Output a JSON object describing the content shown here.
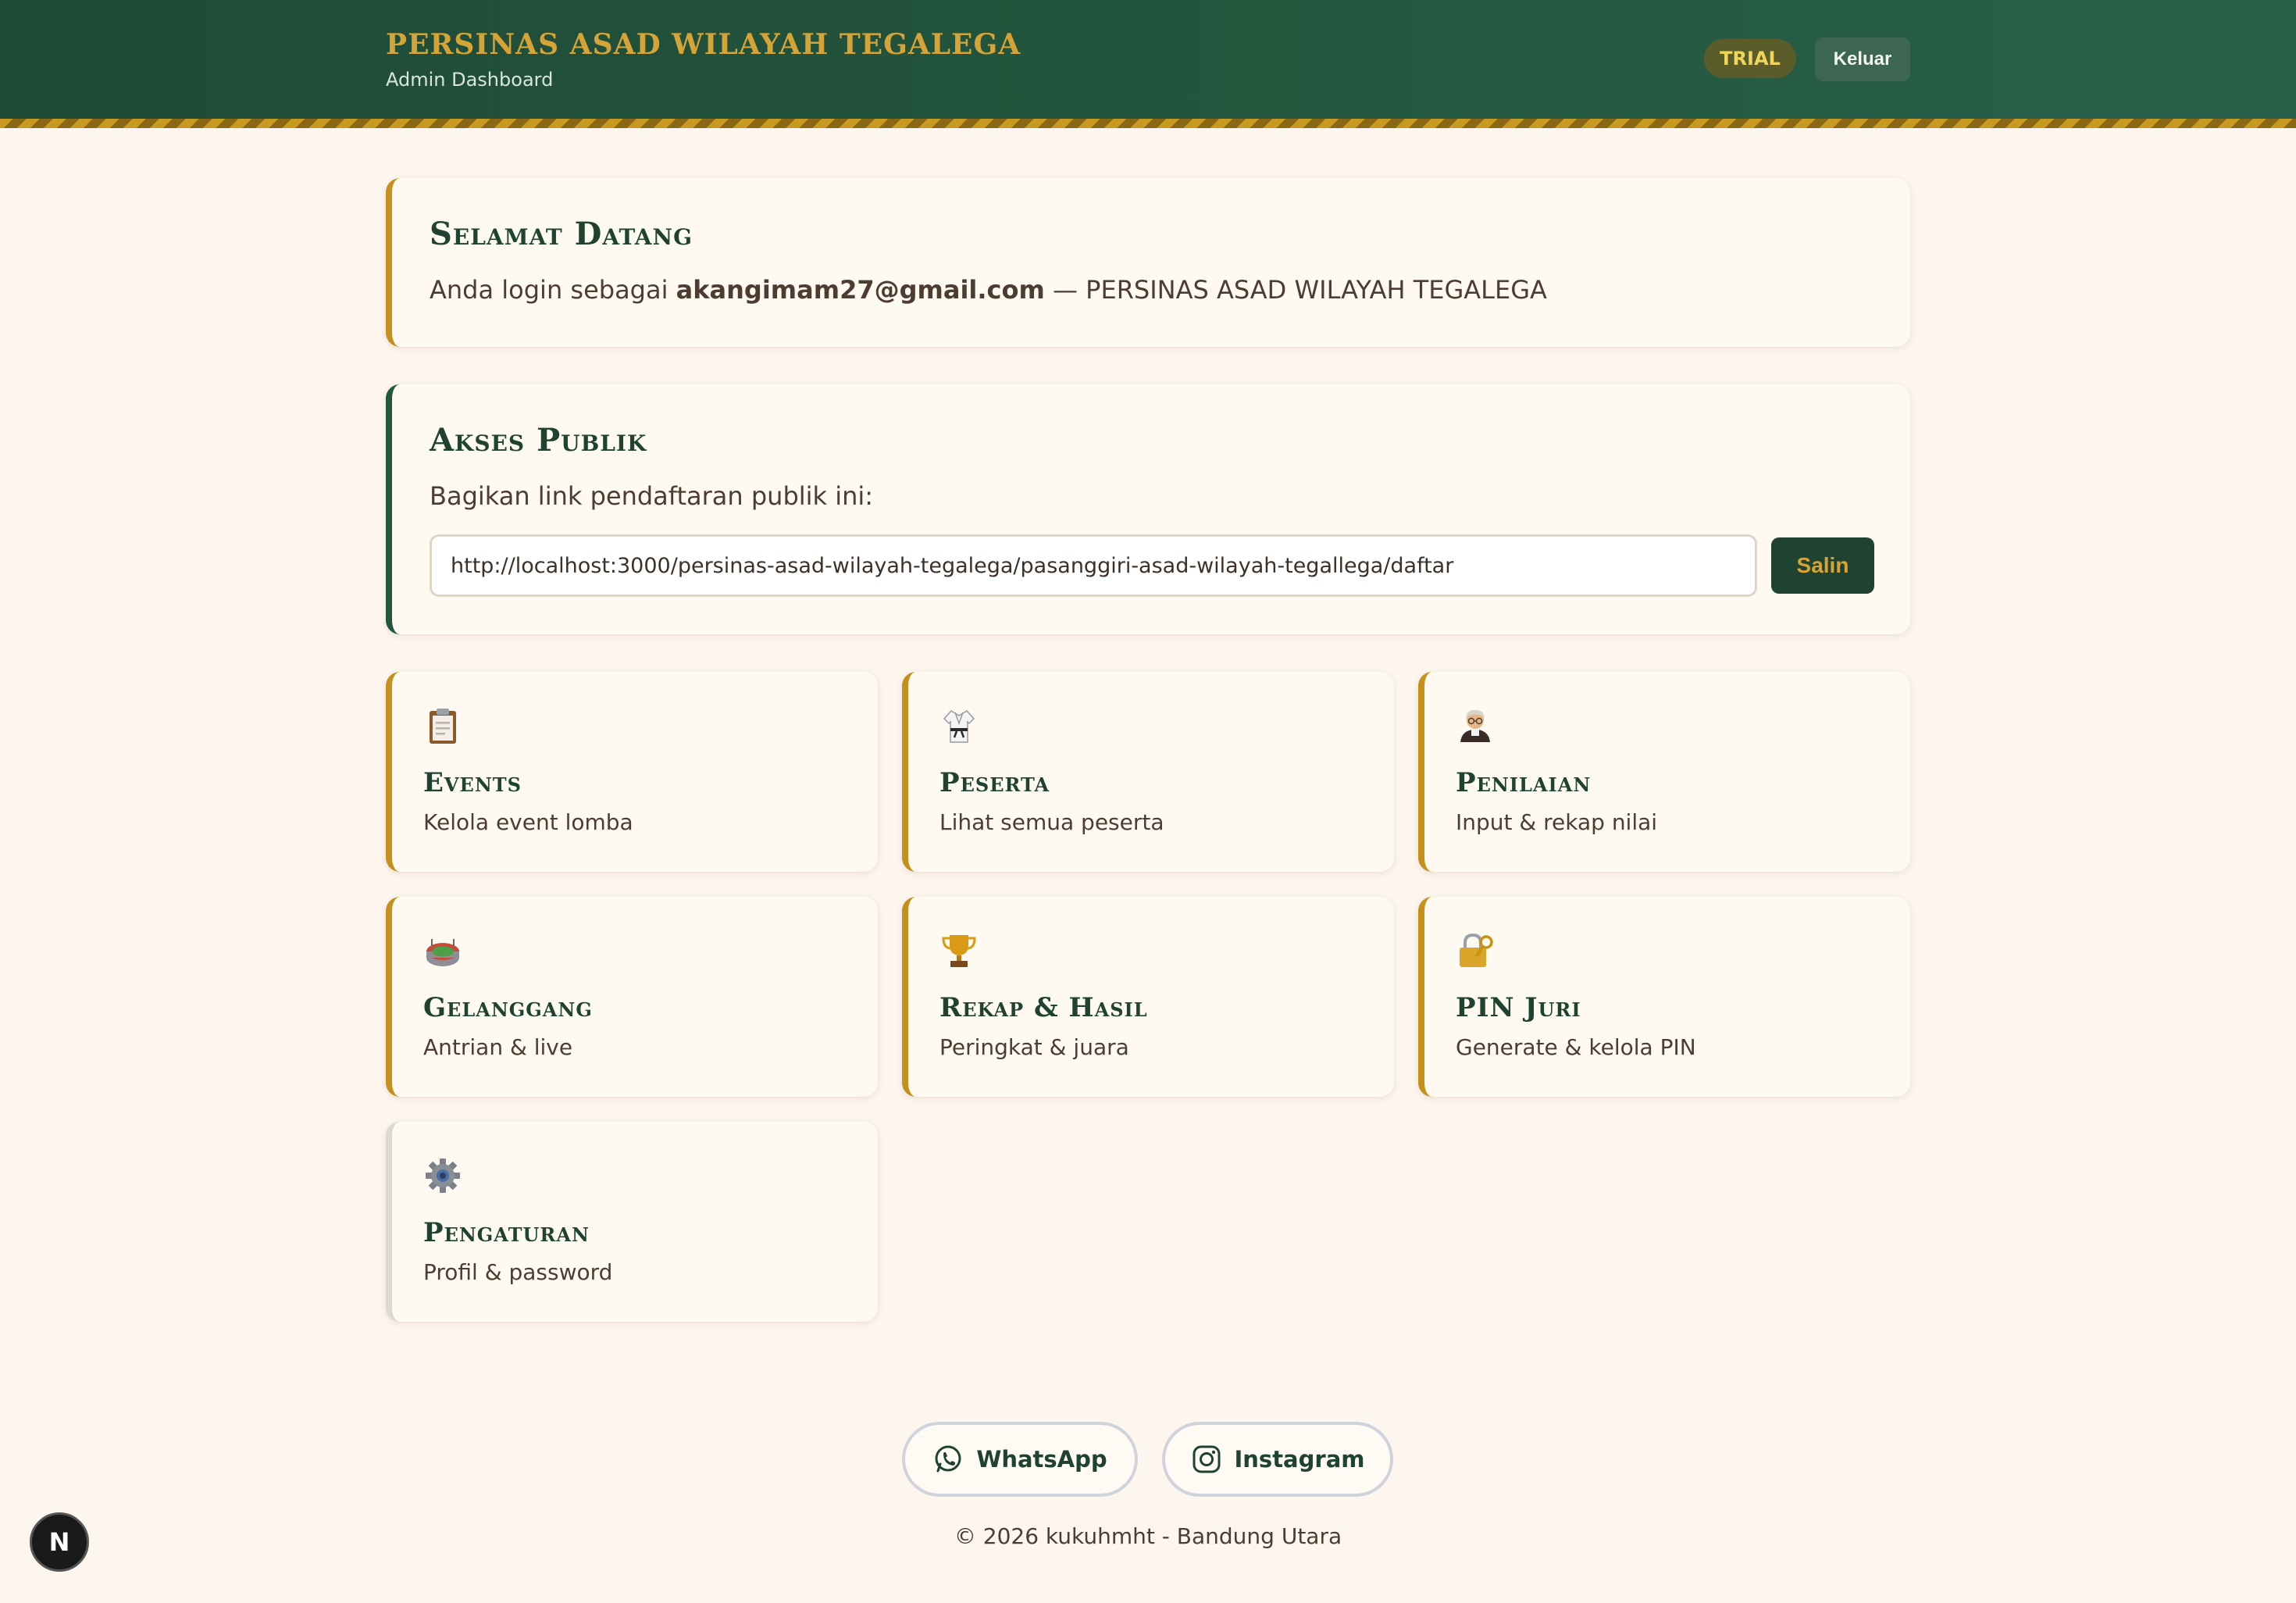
{
  "header": {
    "org_name": "PERSINAS ASAD WILAYAH TEGALEGA",
    "subtitle": "Admin Dashboard",
    "plan_badge": "TRIAL",
    "logout_label": "Keluar"
  },
  "welcome": {
    "title": "Selamat Datang",
    "prefix": "Anda login sebagai",
    "email": "akangimam27@gmail.com",
    "suffix": "— PERSINAS ASAD WILAYAH TEGALEGA"
  },
  "public_access": {
    "title": "Akses Publik",
    "description": "Bagikan link pendaftaran publik ini:",
    "url": "http://localhost:3000/persinas-asad-wilayah-tegalega/pasanggiri-asad-wilayah-tegallega/daftar",
    "copy_label": "Salin"
  },
  "menu": [
    {
      "icon": "clipboard-icon",
      "title": "Events",
      "desc": "Kelola event lomba"
    },
    {
      "icon": "martial-arts-uniform-icon",
      "title": "Peserta",
      "desc": "Lihat semua peserta"
    },
    {
      "icon": "judge-icon",
      "title": "Penilaian",
      "desc": "Input & rekap nilai"
    },
    {
      "icon": "stadium-icon",
      "title": "Gelanggang",
      "desc": "Antrian & live"
    },
    {
      "icon": "trophy-icon",
      "title": "Rekap & Hasil",
      "desc": "Peringkat & juara"
    },
    {
      "icon": "lock-key-icon",
      "title": "PIN Juri",
      "desc": "Generate & kelola PIN"
    },
    {
      "icon": "gear-icon",
      "title": "Pengaturan",
      "desc": "Profil & password"
    }
  ],
  "footer": {
    "whatsapp_label": "WhatsApp",
    "instagram_label": "Instagram",
    "copyright": "© 2026 kukuhmht - Bandung Utara"
  },
  "dev_badge": "N",
  "colors": {
    "header_green": "#1f4a36",
    "accent_gold": "#c4921c",
    "accent_green": "#22573f",
    "background": "#fdf6ee"
  }
}
